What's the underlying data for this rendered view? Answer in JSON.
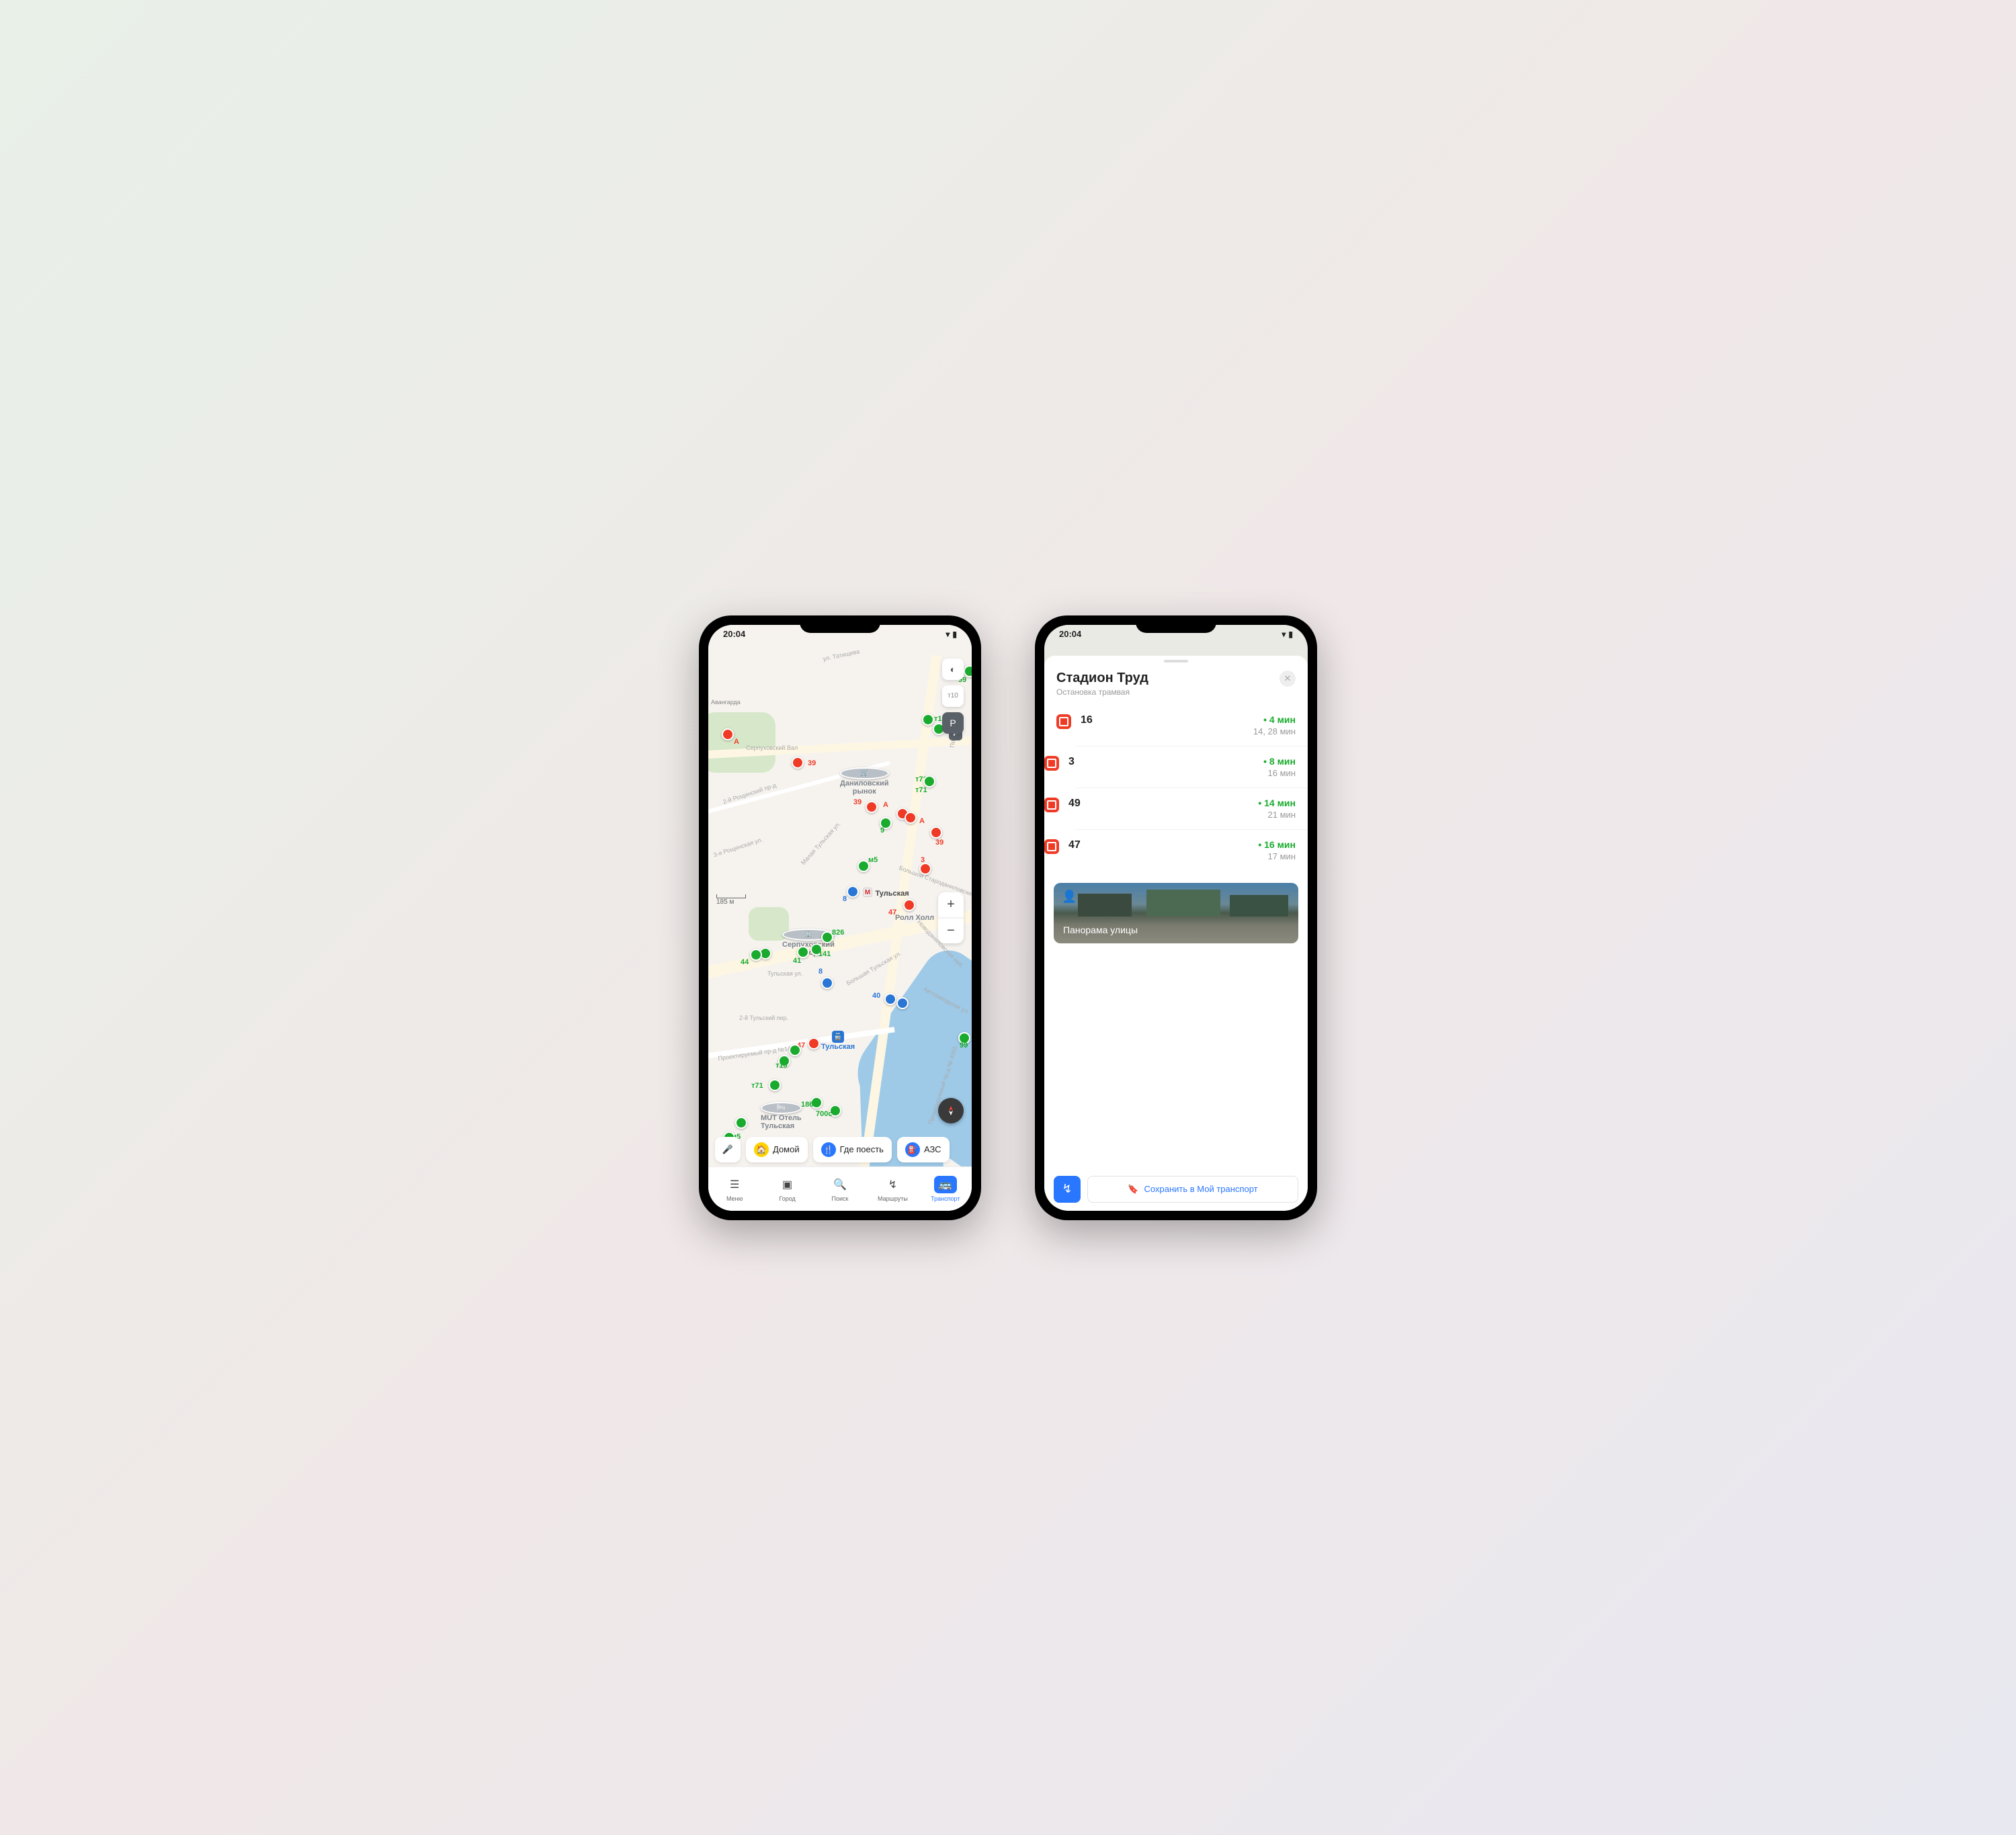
{
  "statusbar": {
    "time": "20:04"
  },
  "map": {
    "scale": "185 м",
    "chips": {
      "voice": "🎤",
      "home": "Домой",
      "food": "Где поесть",
      "gas": "АЗС"
    },
    "nav": {
      "menu": "Меню",
      "city": "Город",
      "search": "Поиск",
      "routes": "Маршруты",
      "transport": "Транспорт"
    },
    "streets": {
      "tatischeva": "ул. Татищева",
      "serpuhov_val": "Серпуховский Вал",
      "roshchinsky": "2-й Рощинский пр-д",
      "roshchinsky3": "3-я Рощинская ул.",
      "m_tulskaya": "Малая Тульская ул.",
      "b_tulskaya": "Большая Тульская ул.",
      "tulskaya": "Тульская ул.",
      "tulsky2": "2-й Тульский пер.",
      "proektiruemy": "Проектируемый пр-д №1423",
      "proektiruemy2": "Проектируемый пр-д № 4965",
      "b_starodanilov": "Большой Староданиловский пер.",
      "podolskoe": "Подольск",
      "novodanilov": "Новоданиловская наб.",
      "avtozavod": "Автозаводская ул.",
      "avangarda": "Авангарда"
    },
    "pois": {
      "danilovsky": "Даниловский\nрынок",
      "serp_dvor": "Серпуховский\nДвор",
      "tulskaya_metro": "Тульская",
      "tulskaya_rail": "Тульская",
      "roll_hall": "Ролл Холл",
      "mut_hotel": "MUT Отель\nТульская"
    },
    "marker_labels": [
      "А",
      "А",
      "А",
      "39",
      "39",
      "39",
      "39",
      "т10",
      "т71",
      "т71",
      "т71",
      "826",
      "м5",
      "м5",
      "8",
      "8",
      "9",
      "3",
      "40",
      "44",
      "41",
      "186",
      "700с",
      "47",
      "47",
      "99",
      "99",
      "141"
    ]
  },
  "detail": {
    "title": "Стадион Труд",
    "subtitle": "Остановка трамвая",
    "routes": [
      {
        "num": "16",
        "eta": "4 мин",
        "next": "14, 28 мин"
      },
      {
        "num": "3",
        "eta": "8 мин",
        "next": "16 мин"
      },
      {
        "num": "49",
        "eta": "14 мин",
        "next": "21 мин"
      },
      {
        "num": "47",
        "eta": "16 мин",
        "next": "17 мин"
      }
    ],
    "panorama": "Панорама улицы",
    "save": "Сохранить в Мой транспорт"
  }
}
